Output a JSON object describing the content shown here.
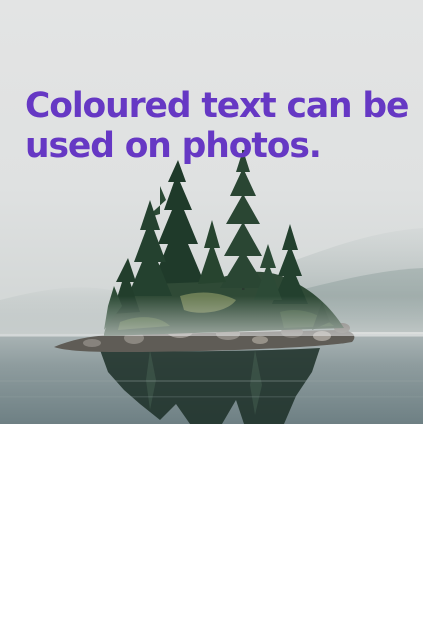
{
  "photo": {
    "icon": "island-lake-photo",
    "colors": {
      "sky": "#e3e4e4",
      "water": "#7f8f92",
      "forest": "#1e3a2c",
      "rock": "#6b6862"
    }
  },
  "headline": {
    "line1": "Coloured text can be",
    "line2": "used on photos.",
    "color": "#6638c4"
  }
}
